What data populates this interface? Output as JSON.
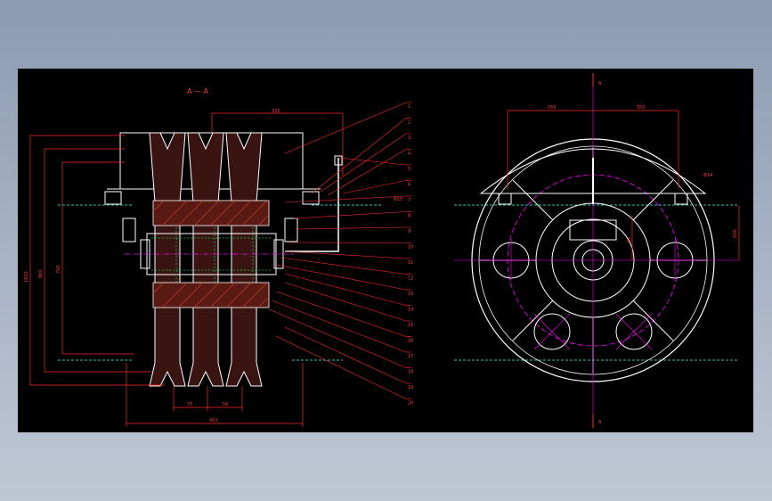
{
  "drawing": {
    "section_label": "A — A",
    "section_marker_top": "A",
    "section_marker_bottom": "A",
    "dimensions": {
      "top_width": "330",
      "bottom_width": "410",
      "pitch_1": "75",
      "pitch_2": "50",
      "height_outer": "1000",
      "height_mid": "860",
      "height_inner": "700",
      "side_small": "200",
      "right_radius_left": "555",
      "right_radius_right": "555",
      "right_vertical": "500",
      "right_small": "95"
    },
    "callout_numbers": [
      "1",
      "2",
      "3",
      "4",
      "5",
      "6",
      "7",
      "8",
      "9",
      "10",
      "11",
      "12",
      "13",
      "14",
      "15",
      "16",
      "17",
      "18",
      "19",
      "20"
    ],
    "callout_note_left": "Φ15",
    "callout_note_right": "Φ14",
    "colors": {
      "outline": "#ffffff",
      "dimension": "#ff2a2a",
      "hatch": "#c0392b",
      "centerline": "#ff00ff",
      "ground": "#2ec4b6",
      "leader_cyan": "#00e5ff",
      "green": "#00c853"
    }
  }
}
